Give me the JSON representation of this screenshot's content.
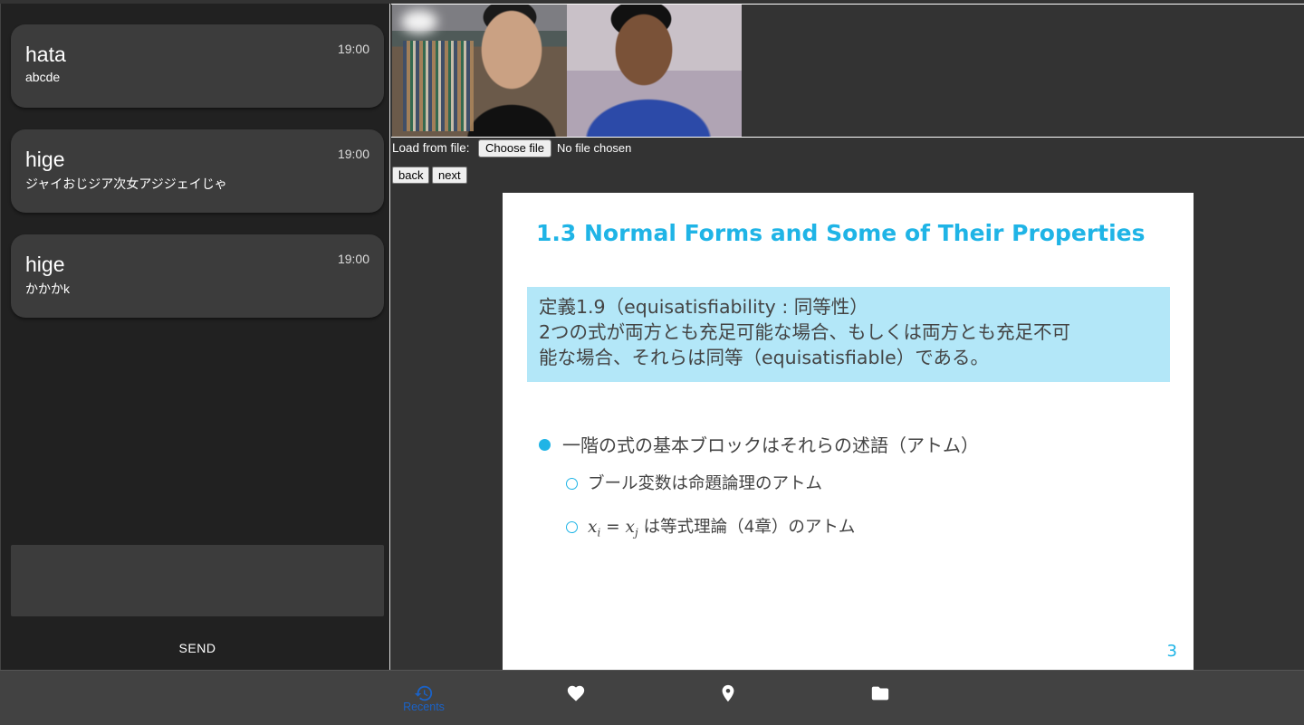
{
  "chat": {
    "messages": [
      {
        "name": "hata",
        "time": "19:00",
        "text": "abcde"
      },
      {
        "name": "hige",
        "time": "19:00",
        "text": "ジャイおじジア次女アジジェイじゃ"
      },
      {
        "name": "hige",
        "time": "19:00",
        "text": "かかかk"
      }
    ],
    "input_value": "",
    "send_label": "SEND"
  },
  "file_loader": {
    "label": "Load from file:",
    "button_label": "Choose file",
    "status": "No file chosen"
  },
  "slide_nav": {
    "back_label": "back",
    "next_label": "next"
  },
  "slide": {
    "title": "1.3 Normal Forms and Some of Their Properties",
    "definition_line1": "定義1.9（equisatisfiability : 同等性）",
    "definition_line2": "2つの式が両方とも充足可能な場合、もしくは両方とも充足不可",
    "definition_line3": "能な場合、それらは同等（equisatisfiable）である。",
    "bullet_main": "一階の式の基本ブロックはそれらの述語（アトム）",
    "sub_bullet_1": "ブール変数は命題論理のアトム",
    "sub_bullet_2_math_left": "x",
    "sub_bullet_2_math_left_sub": "i",
    "sub_bullet_2_math_eq": " = ",
    "sub_bullet_2_math_right": "x",
    "sub_bullet_2_math_right_sub": "j",
    "sub_bullet_2_text": " は等式理論（4章）のアトム",
    "page_number": "3"
  },
  "bottom_nav": {
    "items": [
      {
        "label": "Recents",
        "icon": "history-icon",
        "active": true
      },
      {
        "label": "",
        "icon": "heart-icon",
        "active": false
      },
      {
        "label": "",
        "icon": "location-pin-icon",
        "active": false
      },
      {
        "label": "",
        "icon": "folder-icon",
        "active": false
      }
    ],
    "active_color": "#1a62c7",
    "inactive_color": "#ffffff"
  },
  "colors": {
    "accent": "#1fb4e6",
    "definition_box": "#b3e7f8",
    "panel_bg": "#212121",
    "card_bg": "#3c3c3c"
  }
}
